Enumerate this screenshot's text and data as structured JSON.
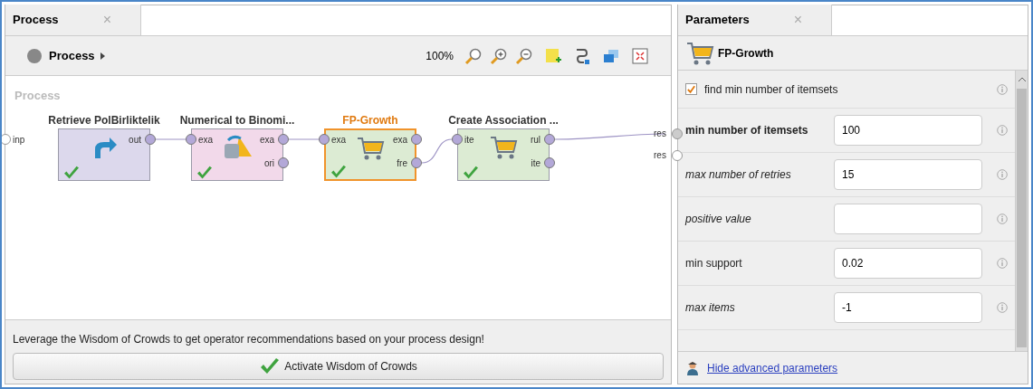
{
  "process_panel": {
    "tab": {
      "title": "Process",
      "close": "×"
    },
    "breadcrumb": "Process",
    "zoom": "100%",
    "canvas_label": "Process",
    "input_port": "inp",
    "output_ports": [
      "res",
      "res"
    ],
    "operators": [
      {
        "name": "Retrieve PolBirliktelik",
        "color": "#dcd8ec",
        "selected": false,
        "kind": "retrieve",
        "outputs": [
          "out"
        ]
      },
      {
        "name": "Numerical to Binomi...",
        "color": "#f2d9ea",
        "selected": false,
        "kind": "convert",
        "inputs": [
          "exa"
        ],
        "outputs": [
          "exa",
          "ori"
        ]
      },
      {
        "name": "FP-Growth",
        "color": "#dcebd3",
        "selected": true,
        "kind": "mining",
        "inputs": [
          "exa"
        ],
        "outputs": [
          "exa",
          "fre"
        ]
      },
      {
        "name": "Create Association ...",
        "color": "#dcebd3",
        "selected": false,
        "kind": "mining",
        "inputs": [
          "ite"
        ],
        "outputs": [
          "rul",
          "ite"
        ]
      }
    ],
    "wisdom_message": "Leverage the Wisdom of Crowds to get operator recommendations based on your process design!",
    "wisdom_button": "Activate Wisdom of Crowds"
  },
  "parameters_panel": {
    "tab": {
      "title": "Parameters",
      "close": "×"
    },
    "operator": "FP-Growth",
    "parameters": [
      {
        "kind": "checkbox",
        "label": "find min number of itemsets",
        "checked": true
      },
      {
        "kind": "required",
        "label": "min number of itemsets",
        "value": "100"
      },
      {
        "kind": "optional",
        "label": "max number of retries",
        "value": "15"
      },
      {
        "kind": "optional",
        "label": "positive value"
      },
      {
        "kind": "field",
        "label": "min support",
        "value": "0.02"
      },
      {
        "kind": "optional",
        "label": "max items",
        "value": "-1"
      }
    ],
    "link": "Hide advanced parameters"
  }
}
